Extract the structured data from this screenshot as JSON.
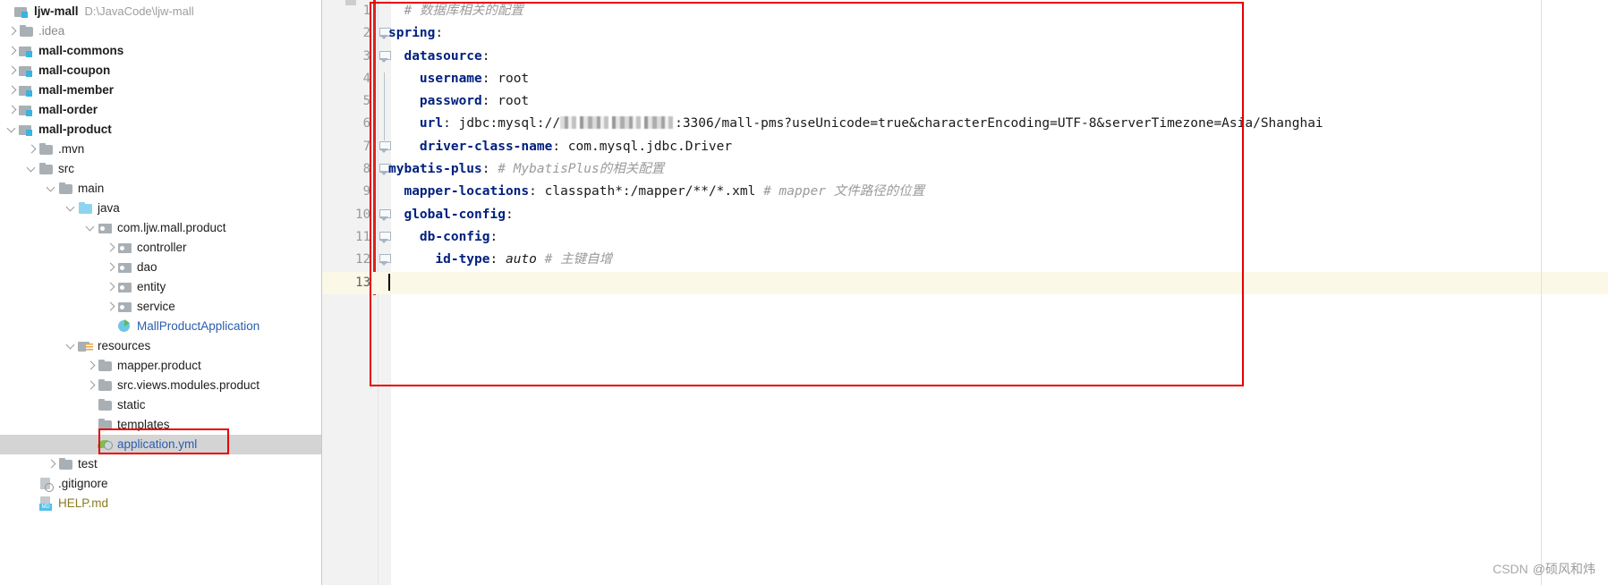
{
  "project": {
    "root_label": "ljw-mall",
    "root_path": "D:\\JavaCode\\ljw-mall",
    "tree": [
      {
        "label": ".idea",
        "indent": 1,
        "arrow": "right",
        "icon": "folder",
        "style": "muted"
      },
      {
        "label": "mall-commons",
        "indent": 1,
        "arrow": "right",
        "icon": "module",
        "style": "bold"
      },
      {
        "label": "mall-coupon",
        "indent": 1,
        "arrow": "right",
        "icon": "module",
        "style": "bold"
      },
      {
        "label": "mall-member",
        "indent": 1,
        "arrow": "right",
        "icon": "module",
        "style": "bold"
      },
      {
        "label": "mall-order",
        "indent": 1,
        "arrow": "right",
        "icon": "module",
        "style": "bold"
      },
      {
        "label": "mall-product",
        "indent": 1,
        "arrow": "down",
        "icon": "module",
        "style": "bold"
      },
      {
        "label": ".mvn",
        "indent": 2,
        "arrow": "right",
        "icon": "folder",
        "style": "normal"
      },
      {
        "label": "src",
        "indent": 2,
        "arrow": "down",
        "icon": "folder",
        "style": "normal"
      },
      {
        "label": "main",
        "indent": 3,
        "arrow": "down",
        "icon": "folder",
        "style": "normal"
      },
      {
        "label": "java",
        "indent": 4,
        "arrow": "down",
        "icon": "srcfolder",
        "style": "normal"
      },
      {
        "label": "com.ljw.mall.product",
        "indent": 5,
        "arrow": "down",
        "icon": "package",
        "style": "normal"
      },
      {
        "label": "controller",
        "indent": 6,
        "arrow": "right",
        "icon": "package",
        "style": "normal"
      },
      {
        "label": "dao",
        "indent": 6,
        "arrow": "right",
        "icon": "package",
        "style": "normal"
      },
      {
        "label": "entity",
        "indent": 6,
        "arrow": "right",
        "icon": "package",
        "style": "normal"
      },
      {
        "label": "service",
        "indent": 6,
        "arrow": "right",
        "icon": "package",
        "style": "normal"
      },
      {
        "label": "MallProductApplication",
        "indent": 6,
        "arrow": "none",
        "icon": "springclass",
        "style": "blue"
      },
      {
        "label": "resources",
        "indent": 4,
        "arrow": "down",
        "icon": "resources",
        "style": "normal"
      },
      {
        "label": "mapper.product",
        "indent": 5,
        "arrow": "right",
        "icon": "folder",
        "style": "normal"
      },
      {
        "label": "src.views.modules.product",
        "indent": 5,
        "arrow": "right",
        "icon": "folder",
        "style": "normal"
      },
      {
        "label": "static",
        "indent": 5,
        "arrow": "none",
        "icon": "folder",
        "style": "normal"
      },
      {
        "label": "templates",
        "indent": 5,
        "arrow": "none",
        "icon": "folder",
        "style": "normal"
      },
      {
        "label": "application.yml",
        "indent": 5,
        "arrow": "none",
        "icon": "yml",
        "style": "blue",
        "selected": true
      },
      {
        "label": "test",
        "indent": 3,
        "arrow": "right",
        "icon": "folder",
        "style": "normal"
      },
      {
        "label": ".gitignore",
        "indent": 2,
        "arrow": "none",
        "icon": "gitfile",
        "style": "normal"
      },
      {
        "label": "HELP.md",
        "indent": 2,
        "arrow": "none",
        "icon": "mdfile",
        "style": "olive"
      }
    ]
  },
  "editor": {
    "file": "application.yml",
    "current_line": 13,
    "caret_line": 13,
    "lines": [
      {
        "n": 1,
        "fold": "none",
        "tokens": [
          {
            "t": "  ",
            "c": "p"
          },
          {
            "t": "# 数据库相关的配置",
            "c": "cm"
          }
        ]
      },
      {
        "n": 2,
        "fold": "open",
        "tokens": [
          {
            "t": "spring",
            "c": "k"
          },
          {
            "t": ":",
            "c": "p"
          }
        ]
      },
      {
        "n": 3,
        "fold": "open",
        "tokens": [
          {
            "t": "  ",
            "c": "p"
          },
          {
            "t": "datasource",
            "c": "k"
          },
          {
            "t": ":",
            "c": "p"
          }
        ]
      },
      {
        "n": 4,
        "fold": "line",
        "tokens": [
          {
            "t": "    ",
            "c": "p"
          },
          {
            "t": "username",
            "c": "k"
          },
          {
            "t": ": ",
            "c": "p"
          },
          {
            "t": "root",
            "c": "s"
          }
        ]
      },
      {
        "n": 5,
        "fold": "line",
        "tokens": [
          {
            "t": "    ",
            "c": "p"
          },
          {
            "t": "password",
            "c": "k"
          },
          {
            "t": ": ",
            "c": "p"
          },
          {
            "t": "root",
            "c": "s"
          }
        ]
      },
      {
        "n": 6,
        "fold": "line",
        "tokens": [
          {
            "t": "    ",
            "c": "p"
          },
          {
            "t": "url",
            "c": "k"
          },
          {
            "t": ": ",
            "c": "p"
          },
          {
            "t": "jdbc:mysql://",
            "c": "s"
          },
          {
            "t": "",
            "c": "redacted"
          },
          {
            "t": ":3306/mall-pms?useUnicode=true&characterEncoding=UTF-8&serverTimezone=Asia/Shanghai",
            "c": "s"
          }
        ]
      },
      {
        "n": 7,
        "fold": "open",
        "tokens": [
          {
            "t": "    ",
            "c": "p"
          },
          {
            "t": "driver-class-name",
            "c": "k"
          },
          {
            "t": ": ",
            "c": "p"
          },
          {
            "t": "com.mysql.jdbc.Driver",
            "c": "s"
          }
        ]
      },
      {
        "n": 8,
        "fold": "open",
        "tokens": [
          {
            "t": "mybatis-plus",
            "c": "k"
          },
          {
            "t": ": ",
            "c": "p"
          },
          {
            "t": "# MybatisPlus的相关配置",
            "c": "cm"
          }
        ]
      },
      {
        "n": 9,
        "fold": "none",
        "tokens": [
          {
            "t": "  ",
            "c": "p"
          },
          {
            "t": "mapper-locations",
            "c": "k"
          },
          {
            "t": ": ",
            "c": "p"
          },
          {
            "t": "classpath*:/mapper/**/*.xml ",
            "c": "s"
          },
          {
            "t": "# mapper 文件路径的位置",
            "c": "cm"
          }
        ]
      },
      {
        "n": 10,
        "fold": "open",
        "tokens": [
          {
            "t": "  ",
            "c": "p"
          },
          {
            "t": "global-config",
            "c": "k"
          },
          {
            "t": ":",
            "c": "p"
          }
        ]
      },
      {
        "n": 11,
        "fold": "open",
        "tokens": [
          {
            "t": "    ",
            "c": "p"
          },
          {
            "t": "db-config",
            "c": "k"
          },
          {
            "t": ":",
            "c": "p"
          }
        ]
      },
      {
        "n": 12,
        "fold": "open",
        "tokens": [
          {
            "t": "      ",
            "c": "p"
          },
          {
            "t": "id-type",
            "c": "k"
          },
          {
            "t": ": ",
            "c": "p"
          },
          {
            "t": "auto",
            "c": "va"
          },
          {
            "t": " ",
            "c": "p"
          },
          {
            "t": "# 主键自增",
            "c": "cm"
          }
        ]
      },
      {
        "n": 13,
        "fold": "none",
        "tokens": []
      }
    ]
  },
  "annotations": {
    "code_box_color": "#e60000",
    "yml_box_color": "#e60000"
  },
  "watermark": {
    "brand": "CSDN",
    "author": "@硕风和炜"
  }
}
